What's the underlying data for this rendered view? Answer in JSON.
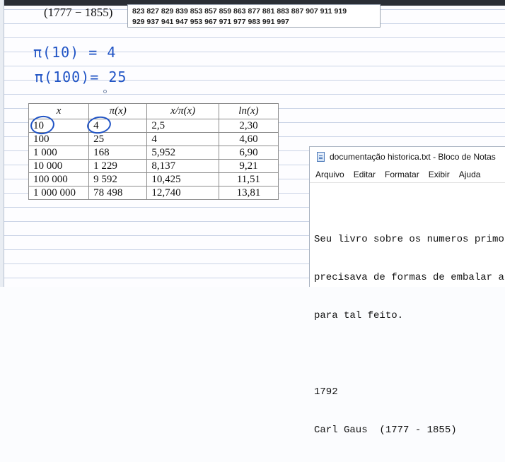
{
  "top": {
    "gauss_years": "(1777 − 1855)",
    "primes_line1": "823 827 829 839 853 857 859 863 877 881 883 887 907 911 919",
    "primes_line2": "929 937 941 947 953 967 971 977 983 991 997"
  },
  "handwriting": {
    "line1": "π(10) = 4",
    "line2": "π(100)= 25"
  },
  "table": {
    "headers": [
      "x",
      "π(x)",
      "x/π(x)",
      "ln(x)"
    ],
    "rows": [
      [
        "10",
        "4",
        "2,5",
        "2,30"
      ],
      [
        "100",
        "25",
        "4",
        "4,60"
      ],
      [
        "1 000",
        "168",
        "5,952",
        "6,90"
      ],
      [
        "10 000",
        "1 229",
        "8,137",
        "9,21"
      ],
      [
        "100 000",
        "9 592",
        "10,425",
        "11,51"
      ],
      [
        "1 000 000",
        "78 498",
        "12,740",
        "13,81"
      ]
    ]
  },
  "notepad": {
    "title": "documentação historica.txt - Bloco de Notas",
    "icon": "notepad-document-icon",
    "menu": [
      "Arquivo",
      "Editar",
      "Formatar",
      "Exibir",
      "Ajuda"
    ],
    "lines": [
      "Seu livro sobre os numeros primos",
      "precisava de formas de embalar as",
      "para tal feito.",
      "",
      "1792",
      "Carl Gaus  (1777 - 1855)"
    ]
  },
  "colors": {
    "ink": "#1f53c5",
    "ruled_line": "#c9d3e6"
  }
}
